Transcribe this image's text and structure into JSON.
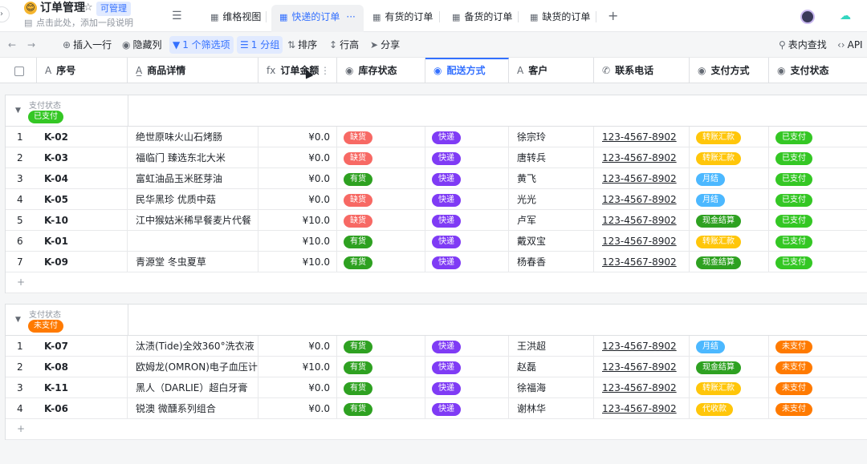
{
  "app": {
    "title": "订单管理",
    "permission": "可管理",
    "description": "点击此处，添加一段说明"
  },
  "tabs": [
    {
      "label": "维格视图",
      "active": false
    },
    {
      "label": "快递的订单",
      "active": true,
      "more": "···"
    },
    {
      "label": "有货的订单",
      "active": false
    },
    {
      "label": "备货的订单",
      "active": false
    },
    {
      "label": "缺货的订单",
      "active": false
    }
  ],
  "toolbar": {
    "insert_row": "插入一行",
    "hide_columns": "隐藏列",
    "filter": "1 个筛选项",
    "group": "1 分组",
    "sort": "排序",
    "row_height": "行高",
    "share": "分享",
    "find": "表内查找",
    "api": "API"
  },
  "columns": [
    {
      "label": "序号",
      "icon": "A"
    },
    {
      "label": "商品详情",
      "icon": "A="
    },
    {
      "label": "订单金额",
      "icon": "fx"
    },
    {
      "label": "库存状态",
      "icon": "◉"
    },
    {
      "label": "配送方式",
      "icon": "◉"
    },
    {
      "label": "客户",
      "icon": "A"
    },
    {
      "label": "联系电话",
      "icon": "✆"
    },
    {
      "label": "支付方式",
      "icon": "◉"
    },
    {
      "label": "支付状态",
      "icon": "◉"
    }
  ],
  "colors": {
    "accent": "#3370ff",
    "paid": "#34c724",
    "unpaid": "#ff7a00",
    "in_stock": "#2ea121",
    "out_stock": "#f54a45",
    "express": "#7f3bf5",
    "transfer": "#ffc60a",
    "monthly": "#4cb8ff",
    "cash": "#2ea121",
    "cod": "#ffc60a"
  },
  "groups": [
    {
      "label": "支付状态",
      "badge": "已支付",
      "badge_color": "#34c724",
      "rows": [
        {
          "n": "1",
          "code": "K-02",
          "product": "绝世原味火山石烤肠",
          "amount": "¥0.0",
          "stock": "缺货",
          "shipping": "快递",
          "customer": "徐宗玲",
          "phone": "123-4567-8902",
          "payment": "转账汇款",
          "status": "已支付"
        },
        {
          "n": "2",
          "code": "K-03",
          "product": "福临门 臻选东北大米",
          "amount": "¥0.0",
          "stock": "缺货",
          "shipping": "快递",
          "customer": "唐转兵",
          "phone": "123-4567-8902",
          "payment": "转账汇款",
          "status": "已支付"
        },
        {
          "n": "3",
          "code": "K-04",
          "product": "富虹油品玉米胚芽油",
          "amount": "¥0.0",
          "stock": "有货",
          "shipping": "快递",
          "customer": "黄飞",
          "phone": "123-4567-8902",
          "payment": "月结",
          "status": "已支付"
        },
        {
          "n": "4",
          "code": "K-05",
          "product": "民华黑珍 优质中菇",
          "amount": "¥0.0",
          "stock": "缺货",
          "shipping": "快递",
          "customer": "光光",
          "phone": "123-4567-8902",
          "payment": "月结",
          "status": "已支付"
        },
        {
          "n": "5",
          "code": "K-10",
          "product": "江中猴姑米稀早餐麦片代餐",
          "amount": "¥10.0",
          "stock": "缺货",
          "shipping": "快递",
          "customer": "卢军",
          "phone": "123-4567-8902",
          "payment": "现金结算",
          "status": "已支付"
        },
        {
          "n": "6",
          "code": "K-01",
          "product": "",
          "amount": "¥10.0",
          "stock": "有货",
          "shipping": "快递",
          "customer": "戴双宝",
          "phone": "123-4567-8902",
          "payment": "转账汇款",
          "status": "已支付"
        },
        {
          "n": "7",
          "code": "K-09",
          "product": "青源堂 冬虫夏草",
          "amount": "¥10.0",
          "stock": "有货",
          "shipping": "快递",
          "customer": "杨春香",
          "phone": "123-4567-8902",
          "payment": "现金结算",
          "status": "已支付"
        }
      ]
    },
    {
      "label": "支付状态",
      "badge": "未支付",
      "badge_color": "#ff7a00",
      "rows": [
        {
          "n": "1",
          "code": "K-07",
          "product": "汰渍(Tide)全效360°洗衣液",
          "amount": "¥0.0",
          "stock": "有货",
          "shipping": "快递",
          "customer": "王洪超",
          "phone": "123-4567-8902",
          "payment": "月结",
          "status": "未支付"
        },
        {
          "n": "2",
          "code": "K-08",
          "product": "欧姆龙(OMRON)电子血压计",
          "amount": "¥10.0",
          "stock": "有货",
          "shipping": "快递",
          "customer": "赵磊",
          "phone": "123-4567-8902",
          "payment": "现金结算",
          "status": "未支付"
        },
        {
          "n": "3",
          "code": "K-11",
          "product": "黑人（DARLIE）超白牙膏",
          "amount": "¥0.0",
          "stock": "有货",
          "shipping": "快递",
          "customer": "徐福海",
          "phone": "123-4567-8902",
          "payment": "转账汇款",
          "status": "未支付"
        },
        {
          "n": "4",
          "code": "K-06",
          "product": "锐澳 微醺系列组合",
          "amount": "¥0.0",
          "stock": "有货",
          "shipping": "快递",
          "customer": "谢林华",
          "phone": "123-4567-8902",
          "payment": "代收款",
          "status": "未支付"
        }
      ]
    }
  ],
  "add_row_label": "+"
}
